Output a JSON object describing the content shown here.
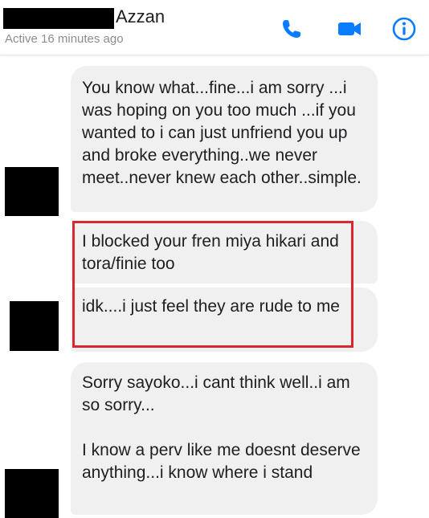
{
  "header": {
    "contact_name": "Azzan",
    "status": "Active 16 minutes ago",
    "accent_color": "#0a7cff",
    "icons": [
      "phone-icon",
      "video-camera-icon",
      "info-icon"
    ]
  },
  "messages": [
    {
      "text": "You know what...fine...i am sorry ...i was hoping on you too much ...if you wanted to i can just unfriend you up and broke everything..we never meet..never knew each other..simple."
    },
    {
      "text": "I blocked your fren miya hikari and tora/finie too"
    },
    {
      "text": "idk....i just feel they are rude to me"
    },
    {
      "text": "Sorry sayoko...i cant think well..i am so sorry...\n\nI know a perv like me doesnt deserve anything...i know where i stand"
    }
  ],
  "annotation": {
    "highlight_color": "#d9262f"
  }
}
